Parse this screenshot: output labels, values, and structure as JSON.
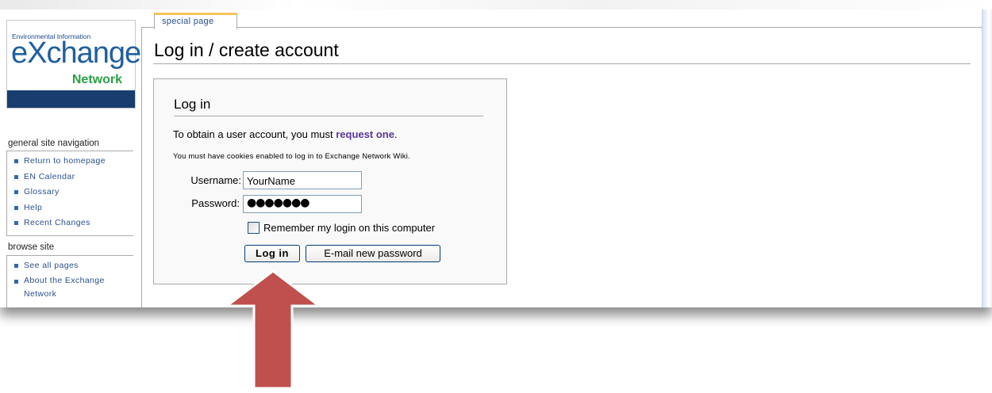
{
  "logo": {
    "top_text": "Environmental Information",
    "word": "eXchange",
    "sub": "Network"
  },
  "sidebar": {
    "nav_heading": "general site navigation",
    "nav_items": [
      {
        "label": "Return to homepage"
      },
      {
        "label": "EN Calendar"
      },
      {
        "label": "Glossary"
      },
      {
        "label": "Help"
      },
      {
        "label": "Recent Changes"
      }
    ],
    "browse_heading": "browse site",
    "browse_items": [
      {
        "label": "See all pages"
      },
      {
        "label": "About the Exchange Network"
      }
    ]
  },
  "tab": {
    "label": "special page"
  },
  "page": {
    "title": "Log in / create account"
  },
  "login": {
    "heading": "Log in",
    "obtain_text": "To obtain a user account, you must",
    "obtain_link": "request one",
    "obtain_end": ".",
    "cookies_text": "You must have cookies enabled to log in to Exchange Network Wiki.",
    "username_label": "Username:",
    "username_value": "YourName",
    "password_label": "Password:",
    "password_mask": "●●●●●●●",
    "remember_label": "Remember my login on this computer",
    "login_button": "Log in",
    "email_button": "E-mail new password"
  },
  "colors": {
    "link": "#2a4f8c",
    "request_link": "#5a3696",
    "tab_accent": "#f3c55b",
    "arrow": "#c0504d"
  },
  "icons": {
    "arrow": "up-arrow-icon",
    "bullet": "square-bullet-icon"
  }
}
